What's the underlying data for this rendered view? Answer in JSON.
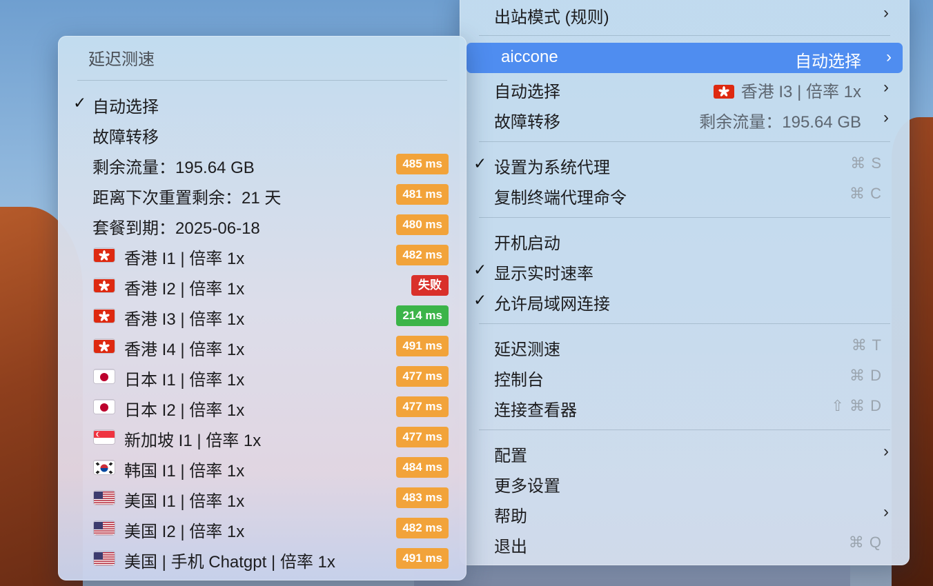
{
  "main_menu": {
    "items": [
      {
        "label": "出站模式 (规则)",
        "chevron": true
      },
      {
        "label": "aiccone",
        "detail": "自动选择",
        "chevron": true,
        "highlighted": true
      },
      {
        "label": "自动选择",
        "detail_flag": "hk",
        "detail": "香港 I3 | 倍率 1x",
        "chevron": true
      },
      {
        "label": "故障转移",
        "detail": "剩余流量：195.64 GB",
        "chevron": true
      },
      {
        "label": "设置为系统代理",
        "checked": true,
        "shortcut": "⌘ S"
      },
      {
        "label": "复制终端代理命令",
        "shortcut": "⌘ C"
      },
      {
        "label": "开机启动"
      },
      {
        "label": "显示实时速率",
        "checked": true
      },
      {
        "label": "允许局域网连接",
        "checked": true
      },
      {
        "label": "延迟测速",
        "shortcut": "⌘ T"
      },
      {
        "label": "控制台",
        "shortcut": "⌘ D"
      },
      {
        "label": "连接查看器",
        "shortcut": "⇧ ⌘ D"
      },
      {
        "label": "配置",
        "chevron": true
      },
      {
        "label": "更多设置"
      },
      {
        "label": "帮助",
        "chevron": true
      },
      {
        "label": "退出",
        "shortcut": "⌘ Q"
      }
    ]
  },
  "sub_menu": {
    "title": "延迟测速",
    "items": [
      {
        "label": "自动选择",
        "checked": true
      },
      {
        "label": "故障转移"
      },
      {
        "label": "剩余流量：195.64 GB",
        "latency": "485 ms",
        "status": "slow"
      },
      {
        "label": "距离下次重置剩余：21 天",
        "latency": "481 ms",
        "status": "slow"
      },
      {
        "label": "套餐到期：2025-06-18",
        "latency": "480 ms",
        "status": "slow"
      },
      {
        "label": "香港 I1 | 倍率 1x",
        "flag": "hk",
        "latency": "482 ms",
        "status": "slow"
      },
      {
        "label": "香港 I2 | 倍率 1x",
        "flag": "hk",
        "latency": "失败",
        "status": "fail"
      },
      {
        "label": "香港 I3 | 倍率 1x",
        "flag": "hk",
        "latency": "214 ms",
        "status": "good"
      },
      {
        "label": "香港 I4 | 倍率 1x",
        "flag": "hk",
        "latency": "491 ms",
        "status": "slow"
      },
      {
        "label": "日本 I1 | 倍率 1x",
        "flag": "jp",
        "latency": "477 ms",
        "status": "slow"
      },
      {
        "label": "日本 I2 | 倍率 1x",
        "flag": "jp",
        "latency": "477 ms",
        "status": "slow"
      },
      {
        "label": "新加坡 I1 | 倍率 1x",
        "flag": "sg",
        "latency": "477 ms",
        "status": "slow"
      },
      {
        "label": "韩国 I1 | 倍率 1x",
        "flag": "kr",
        "latency": "484 ms",
        "status": "slow"
      },
      {
        "label": "美国 I1 | 倍率 1x",
        "flag": "us",
        "latency": "483 ms",
        "status": "slow"
      },
      {
        "label": "美国 I2 | 倍率 1x",
        "flag": "us",
        "latency": "482 ms",
        "status": "slow"
      },
      {
        "label": "美国 | 手机 Chatgpt | 倍率 1x",
        "flag": "us",
        "latency": "491 ms",
        "status": "slow"
      }
    ]
  },
  "colors": {
    "highlight": "#4f8df0",
    "slow": "#f2a33a",
    "good": "#3cb449",
    "fail": "#d9302a"
  }
}
